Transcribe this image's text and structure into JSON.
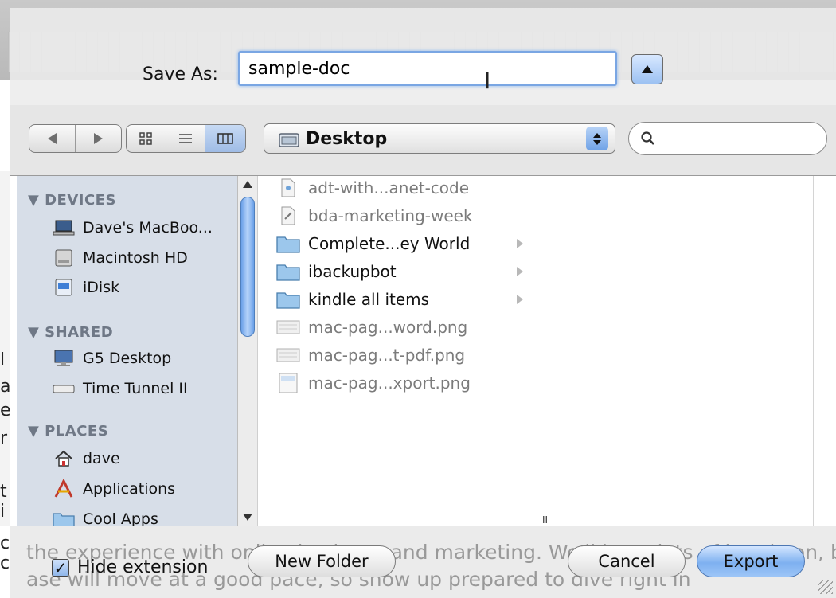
{
  "background": {
    "gutter_letters": [
      "l",
      "a",
      "e",
      "r",
      "t",
      "i",
      "c",
      "c"
    ],
    "text_lines": [
      "the experience with online business and marketing. We'll have lots of hands-on, b",
      "ase will move at a good pace, so show up prepared to dive right in"
    ]
  },
  "save_as": {
    "label": "Save As:",
    "value": "sample-doc"
  },
  "location": {
    "selected": "Desktop"
  },
  "search": {
    "placeholder": ""
  },
  "sidebar": {
    "sections": [
      {
        "title": "▼ DEVICES",
        "items": [
          {
            "label": "Dave's MacBoo...",
            "icon": "laptop-icon"
          },
          {
            "label": "Macintosh HD",
            "icon": "hard-drive-icon"
          },
          {
            "label": "iDisk",
            "icon": "idisk-icon"
          }
        ]
      },
      {
        "title": "▼ SHARED",
        "items": [
          {
            "label": "G5 Desktop",
            "icon": "monitor-icon"
          },
          {
            "label": "Time Tunnel II",
            "icon": "network-drive-icon"
          }
        ]
      },
      {
        "title": "▼ PLACES",
        "items": [
          {
            "label": "dave",
            "icon": "home-icon"
          },
          {
            "label": "Applications",
            "icon": "applications-icon"
          },
          {
            "label": "Cool Apps",
            "icon": "folder-icon"
          }
        ]
      }
    ]
  },
  "files": [
    {
      "name": "adt-with...anet-code",
      "type": "document",
      "enabled": false
    },
    {
      "name": "bda-marketing-week",
      "type": "document",
      "enabled": false
    },
    {
      "name": "Complete...ey World",
      "type": "folder",
      "enabled": true
    },
    {
      "name": "ibackupbot",
      "type": "folder",
      "enabled": true
    },
    {
      "name": "kindle all items",
      "type": "folder",
      "enabled": true
    },
    {
      "name": "mac-pag...word.png",
      "type": "image",
      "enabled": false
    },
    {
      "name": "mac-pag...t-pdf.png",
      "type": "image",
      "enabled": false
    },
    {
      "name": "mac-pag...xport.png",
      "type": "image",
      "enabled": false
    }
  ],
  "footer": {
    "hide_extension_label": "Hide extension",
    "hide_extension_checked": true,
    "new_folder_label": "New Folder",
    "cancel_label": "Cancel",
    "export_label": "Export"
  },
  "colors": {
    "accent": "#7aa6e3",
    "sidebar_bg": "#d7dee8",
    "sidebar_header": "#6f7886"
  }
}
